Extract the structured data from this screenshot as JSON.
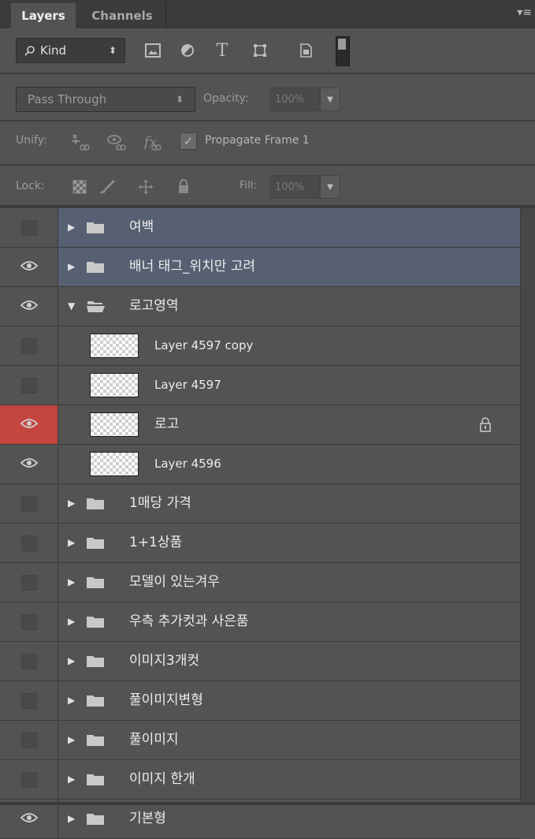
{
  "tabs": {
    "layers": "Layers",
    "channels": "Channels",
    "menu": "▾≡"
  },
  "filter": {
    "kind_label": "Kind",
    "kind_arrows": "⬍",
    "icons": [
      "image-filter-icon",
      "adjustment-filter-icon",
      "type-filter-icon",
      "shape-filter-icon",
      "smart-object-filter-icon"
    ],
    "type_glyph": "T"
  },
  "blend": {
    "mode": "Pass Through",
    "arrows": "⬍",
    "opacity_label": "Opacity:",
    "opacity_value": "100%"
  },
  "unify": {
    "label": "Unify:",
    "propagate_label": "Propagate Frame 1",
    "propagate_checked": true,
    "check_glyph": "✓"
  },
  "lock": {
    "label": "Lock:",
    "fill_label": "Fill:",
    "fill_value": "100%"
  },
  "colors": {
    "selected_row": "#566072",
    "visibility_highlight": "#c54540",
    "panel_bg": "#535353"
  },
  "layers": [
    {
      "name": "여백",
      "type": "group",
      "expanded": false,
      "visible": false,
      "selected": true
    },
    {
      "name": "배너 태그_위치만 고려",
      "type": "group",
      "expanded": false,
      "visible": true,
      "selected": true
    },
    {
      "name": "로고영역",
      "type": "group",
      "expanded": true,
      "visible": true,
      "selected": false
    },
    {
      "name": "Layer 4597 copy",
      "type": "layer",
      "visible": false
    },
    {
      "name": "Layer 4597",
      "type": "layer",
      "visible": false
    },
    {
      "name": "로고",
      "type": "layer",
      "visible": true,
      "visibility_highlight": true,
      "locked": true
    },
    {
      "name": "Layer 4596",
      "type": "layer",
      "visible": true
    },
    {
      "name": "1매당 가격",
      "type": "group",
      "expanded": false,
      "visible": false
    },
    {
      "name": "1+1상품",
      "type": "group",
      "expanded": false,
      "visible": false
    },
    {
      "name": "모델이 있는겨우",
      "type": "group",
      "expanded": false,
      "visible": false
    },
    {
      "name": "우측 추가컷과 사은품",
      "type": "group",
      "expanded": false,
      "visible": false
    },
    {
      "name": "이미지3개컷",
      "type": "group",
      "expanded": false,
      "visible": false
    },
    {
      "name": "풀이미지변형",
      "type": "group",
      "expanded": false,
      "visible": false
    },
    {
      "name": "풀이미지",
      "type": "group",
      "expanded": false,
      "visible": false
    },
    {
      "name": "이미지 한개",
      "type": "group",
      "expanded": false,
      "visible": false
    },
    {
      "name": "기본형",
      "type": "group",
      "expanded": false,
      "visible": true
    }
  ]
}
